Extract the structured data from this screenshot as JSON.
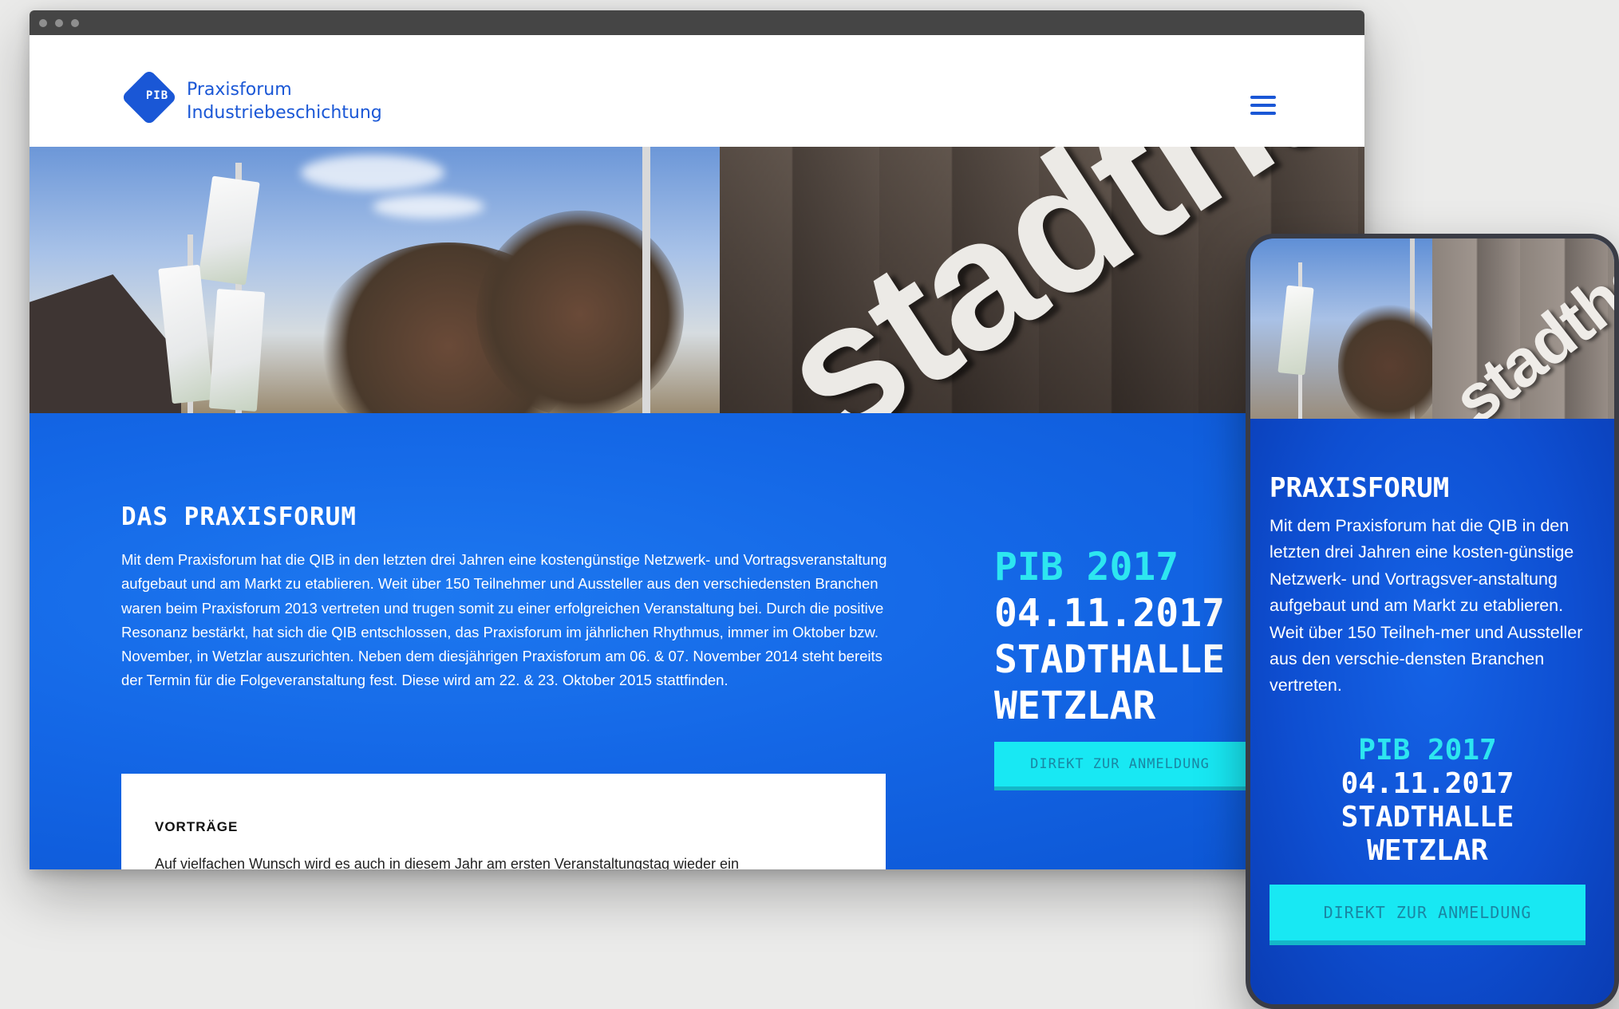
{
  "site": {
    "logo_mark": "PIB",
    "logo_title_line1": "Praxisforum",
    "logo_title_line2": "Industriebeschichtung",
    "menu_icon": "hamburger-menu-icon"
  },
  "desktop": {
    "hero_sign": "stadthalle",
    "section_title": "DAS PRAXISFORUM",
    "section_text": "Mit dem Praxisforum hat die QIB in den letzten drei Jahren eine kostengünstige Netzwerk- und Vortragsveranstaltung aufgebaut und am Markt zu etablieren. Weit über 150 Teilnehmer und Aussteller aus den verschiedensten Branchen waren beim Praxisforum 2013 vertreten und trugen somit zu einer erfolgreichen Veranstaltung bei. Durch die positive Resonanz bestärkt, hat sich die QIB entschlossen, das Praxisforum im jährlichen Rhythmus, immer im Oktober bzw. November, in Wetzlar auszurichten. Neben dem diesjährigen Praxisforum am 06. & 07. November 2014 steht bereits der Termin für die Folgeveranstaltung fest. Diese wird am 22. & 23. Oktober 2015 stattfinden.",
    "event_name": "PIB 2017",
    "event_date": "04.11.2017",
    "event_venue": "STADTHALLE",
    "event_city": "WETZLAR",
    "cta_label": "DIREKT ZUR ANMELDUNG",
    "card_title": "VORTRÄGE",
    "card_text": "Auf vielfachen Wunsch wird es auch in diesem Jahr am ersten Veranstaltungstag wieder ein"
  },
  "mobile": {
    "hero_sign": "stadthalle",
    "section_title": "PRAXISFORUM",
    "section_text": "Mit dem Praxisforum hat die QIB in den letzten drei Jahren eine kosten-günstige Netzwerk- und Vortragsver-anstaltung aufgebaut und am Markt zu etablieren. Weit über 150 Teilneh-mer und Aussteller aus den verschie-densten Branchen vertreten.",
    "event_name": "PIB 2017",
    "event_date": "04.11.2017",
    "event_venue": "STADTHALLE",
    "event_city": "WETZLAR",
    "cta_label": "DIREKT ZUR ANMELDUNG"
  },
  "colors": {
    "brand_blue": "#1a57d6",
    "section_blue": "#1467e6",
    "accent_cyan": "#2de6f0",
    "button_cyan": "#18e8f3",
    "button_text": "#1a86a3"
  }
}
